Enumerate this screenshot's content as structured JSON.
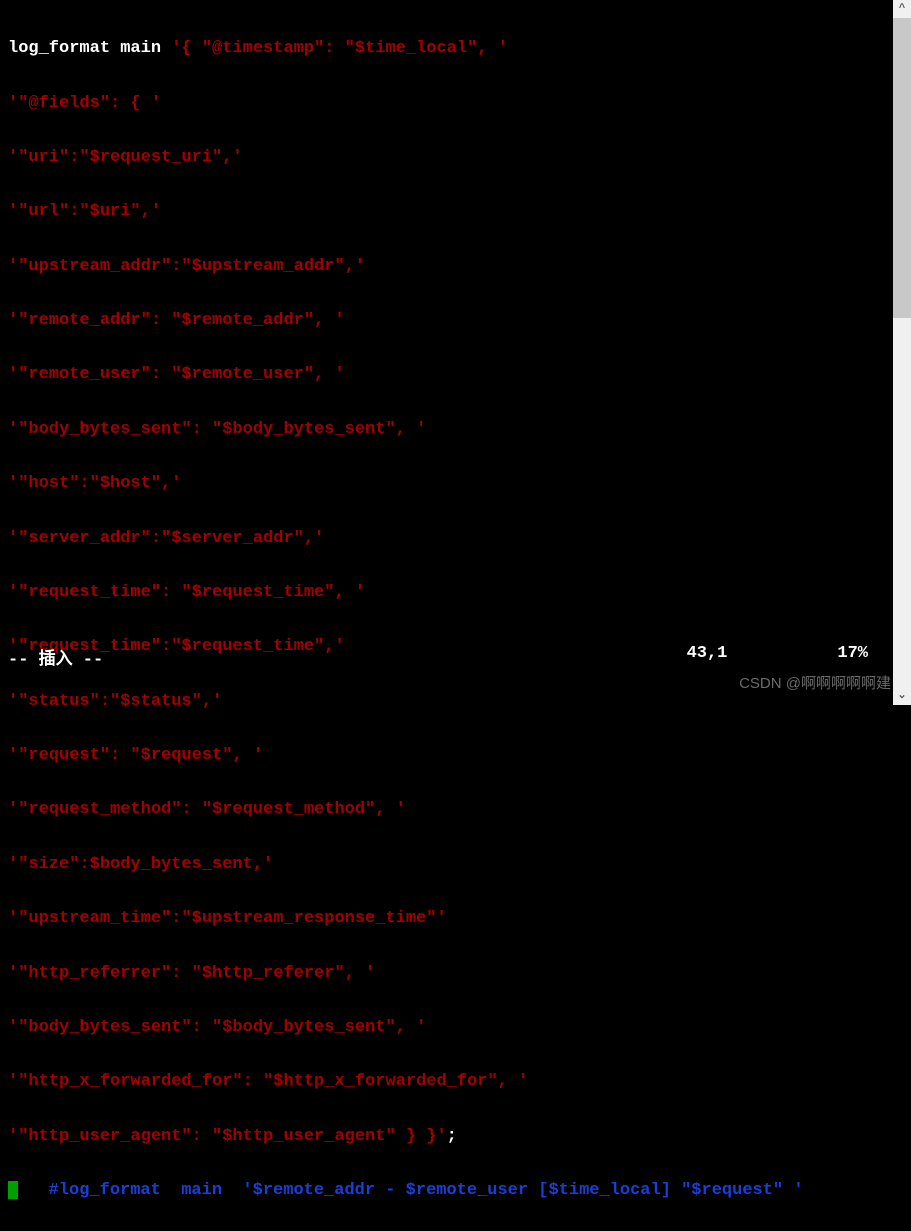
{
  "lines": {
    "l0_pre": "",
    "l0_white": "log_format main ",
    "l0_red": "'{ \"@timestamp\": \"$time_local\", '",
    "l1": "'\"@fields\": { '",
    "l2": "'\"uri\":\"$request_uri\",'",
    "l3": "'\"url\":\"$uri\",'",
    "l4": "'\"upstream_addr\":\"$upstream_addr\",'",
    "l5": "'\"remote_addr\": \"$remote_addr\", '",
    "l6": "'\"remote_user\": \"$remote_user\", '",
    "l7": "'\"body_bytes_sent\": \"$body_bytes_sent\", '",
    "l8": "'\"host\":\"$host\",'",
    "l9": "'\"server_addr\":\"$server_addr\",'",
    "l10": "'\"request_time\": \"$request_time\", '",
    "l11": "'\"request_time\":\"$request_time\",'",
    "l12": "'\"status\":\"$status\",'",
    "l13": "'\"request\": \"$request\", '",
    "l14": "'\"request_method\": \"$request_method\", '",
    "l15": "'\"size\":$body_bytes_sent,'",
    "l16": "'\"upstream_time\":\"$upstream_response_time\"'",
    "l17": "'\"http_referrer\": \"$http_referer\", '",
    "l18": "'\"body_bytes_sent\": \"$body_bytes_sent\", '",
    "l19": "'\"http_x_forwarded_for\": \"$http_x_forwarded_for\", '",
    "l20_red": "'\"http_user_agent\": \"$http_user_agent\" } }'",
    "l20_white": ";",
    "l21_blue": "   #log_format  main  '$remote_addr - $remote_user [$time_local] \"$request\" '"
  },
  "status": {
    "mode": "-- 插入 --",
    "position": "43,1",
    "percent": "17%"
  },
  "watermark": "CSDN @啊啊啊啊啊建"
}
